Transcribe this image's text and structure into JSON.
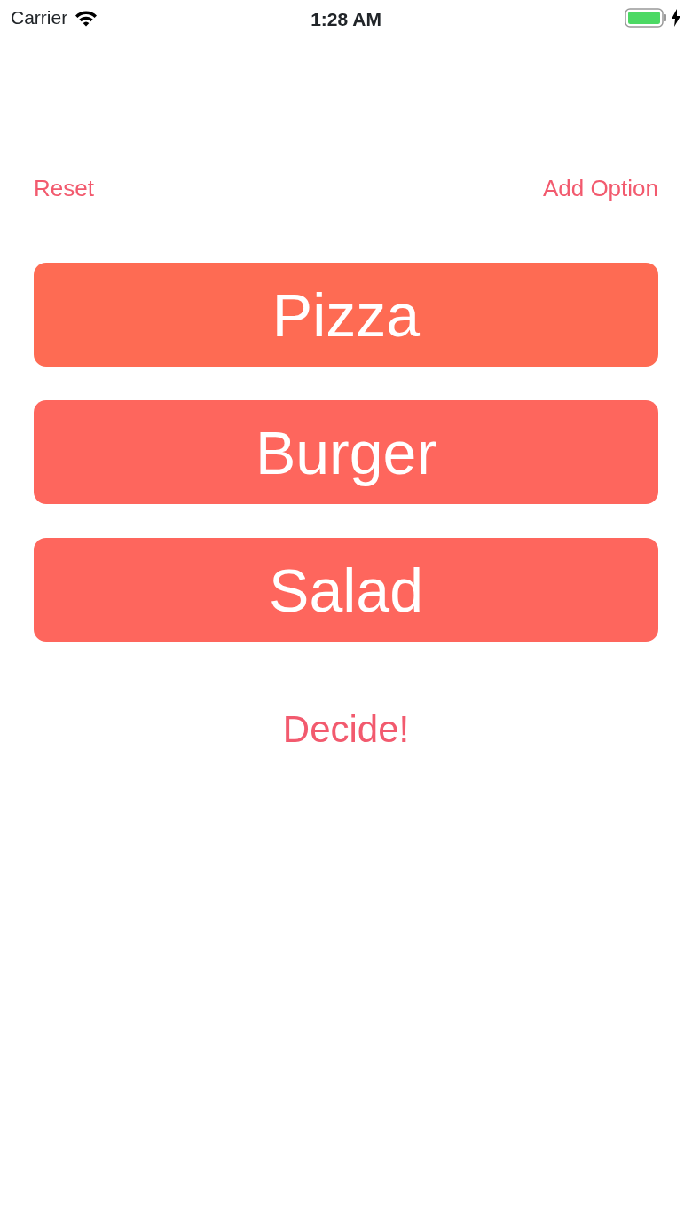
{
  "status_bar": {
    "carrier": "Carrier",
    "time": "1:28 AM",
    "charging": true
  },
  "toolbar": {
    "left": "Reset",
    "right": "Add Option"
  },
  "options": [
    {
      "label": "Pizza",
      "color": "#fe6b53"
    },
    {
      "label": "Burger",
      "color": "#fe665d"
    },
    {
      "label": "Salad",
      "color": "#fe665d"
    }
  ],
  "decide_button": "Decide!"
}
